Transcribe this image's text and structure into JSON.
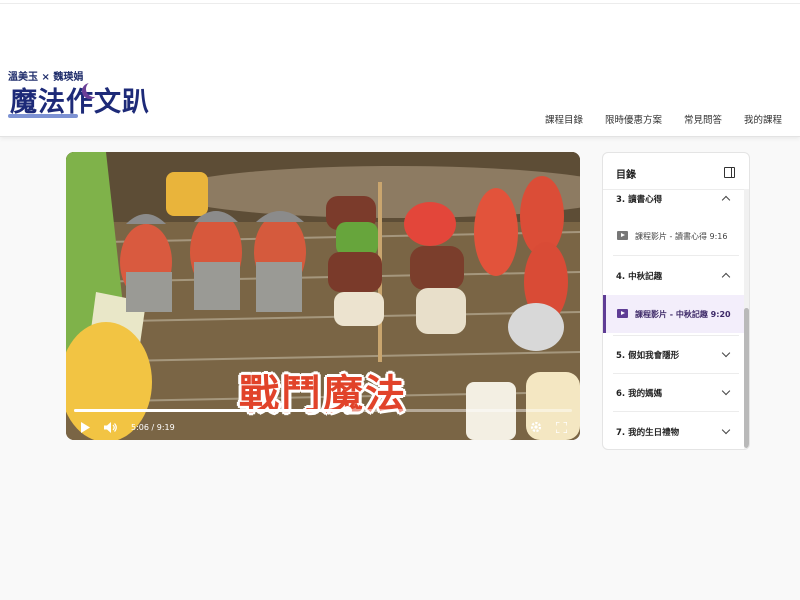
{
  "logo": {
    "top_text": "溫美玉 × 魏瑛娟",
    "main_text": "魔法作文趴"
  },
  "nav": {
    "items": [
      "課程目錄",
      "限時優惠方案",
      "常見問答",
      "我的課程"
    ]
  },
  "video": {
    "title_text": "戰鬥魔法",
    "current_time": "5:06",
    "duration": "9:19",
    "time_separator": "/",
    "progress": 0.548
  },
  "sidebar": {
    "title": "目錄",
    "sections": [
      {
        "title": "3. 讀書心得",
        "expanded": true
      },
      {
        "title": "4. 中秋記趣",
        "expanded": true
      },
      {
        "title": "5. 假如我會隱形",
        "expanded": false
      },
      {
        "title": "6. 我的媽媽",
        "expanded": false
      },
      {
        "title": "7. 我的生日禮物",
        "expanded": false
      }
    ],
    "lessons": [
      {
        "label": "課程影片 - 讀書心得 9:16",
        "active": false
      },
      {
        "label": "課程影片 - 中秋記趣 9:20",
        "active": true
      }
    ]
  },
  "colors": {
    "accent": "#5f3d95",
    "title_red": "#e1432a",
    "active_bg": "#f3eefb"
  }
}
